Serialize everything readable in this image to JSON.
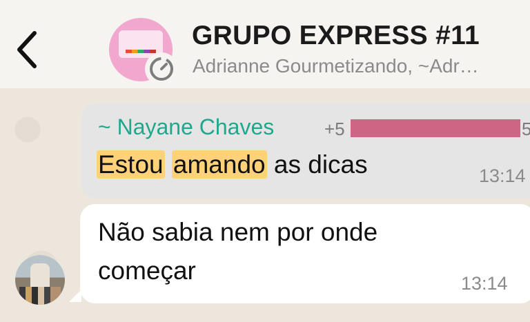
{
  "header": {
    "title": "GRUPO EXPRESS #11",
    "subtitle": "Adrianne Gourmetizando, ~Adr…",
    "back_icon": "chevron-left-icon",
    "avatar_icon": "group-avatar",
    "timer_icon": "disappearing-timer-icon"
  },
  "messages": [
    {
      "sender": "~ Nayane Chaves",
      "phone_prefix": "+5",
      "phone_suffix": "5",
      "text_parts": [
        "Estou",
        " ",
        "amando",
        " as dicas"
      ],
      "time": "13:14"
    },
    {
      "text_line1": "Não sabia nem por onde",
      "text_line2": "começar",
      "time": "13:14"
    }
  ],
  "colors": {
    "sender_name": "#1fa88e",
    "highlight": "#ffd27a",
    "redaction": "#cf6585",
    "group_avatar": "#f2a7cf"
  }
}
